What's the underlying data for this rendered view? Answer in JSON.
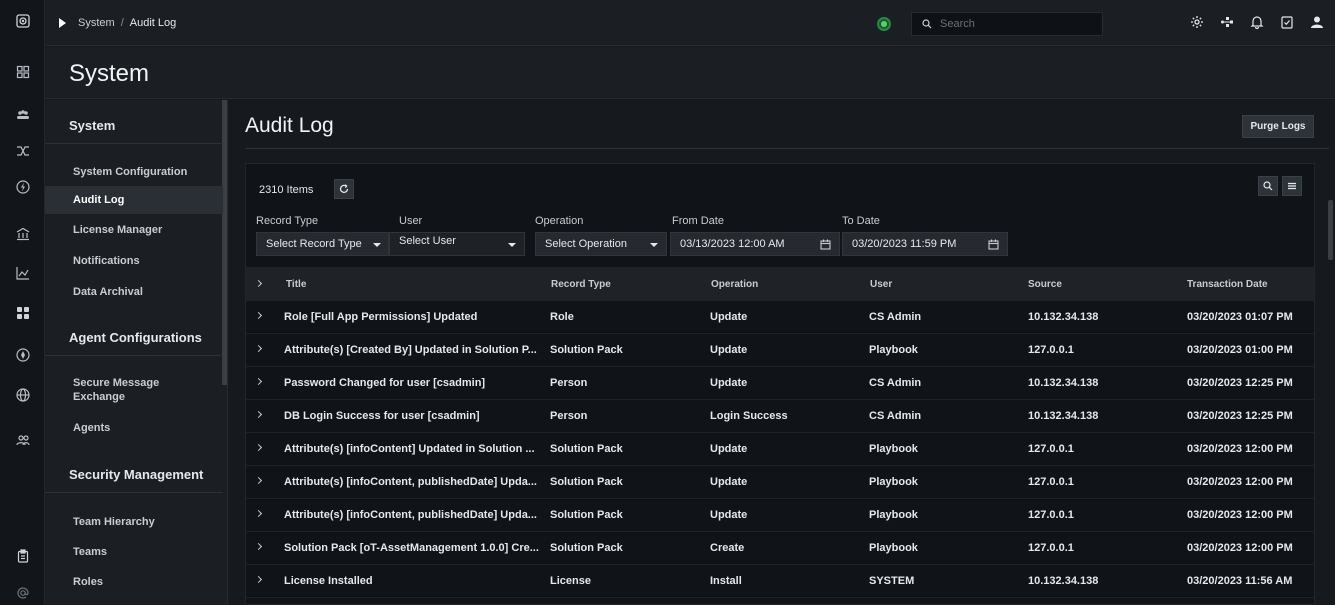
{
  "app": {
    "accent": "#2a8a3b",
    "rail_icons": [
      "logo-icon",
      "dashboard-icon",
      "team-icon",
      "shuffle-icon",
      "lightning-icon",
      "bank-icon",
      "chart-icon",
      "grid-icon",
      "compass-icon",
      "globe-icon",
      "people-icon",
      "clipboard-icon",
      "at-icon"
    ]
  },
  "topbar": {
    "breadcrumb": [
      "System",
      "Audit Log"
    ],
    "breadcrumb_sep": "/",
    "search_placeholder": "Search",
    "icons": [
      "gear-icon",
      "workflow-icon",
      "bell-icon",
      "checklist-icon",
      "user-icon"
    ]
  },
  "page": {
    "title": "System"
  },
  "sidebar": {
    "groups": [
      {
        "title": "System",
        "items": [
          {
            "label": "System Configuration"
          },
          {
            "label": "Audit Log",
            "active": true
          },
          {
            "label": "License Manager"
          },
          {
            "label": "Notifications"
          },
          {
            "label": "Data Archival"
          }
        ]
      },
      {
        "title": "Agent Configurations",
        "items": [
          {
            "label": "Secure Message Exchange"
          },
          {
            "label": "Agents"
          }
        ]
      },
      {
        "title": "Security Management",
        "items": [
          {
            "label": "Team Hierarchy"
          },
          {
            "label": "Teams"
          },
          {
            "label": "Roles"
          }
        ]
      }
    ]
  },
  "main": {
    "title": "Audit Log",
    "purge_label": "Purge Logs",
    "items_count": "2310 Items",
    "filters": {
      "record_type_label": "Record Type",
      "record_type_value": "Select Record Type",
      "user_label": "User",
      "user_value": "Select User",
      "operation_label": "Operation",
      "operation_value": "Select Operation",
      "from_label": "From Date",
      "from_value": "03/13/2023 12:00 AM",
      "to_label": "To Date",
      "to_value": "03/20/2023 11:59 PM"
    },
    "columns": [
      "Title",
      "Record Type",
      "Operation",
      "User",
      "Source",
      "Transaction Date"
    ],
    "rows": [
      [
        "Role [Full App Permissions] Updated",
        "Role",
        "Update",
        "CS Admin",
        "10.132.34.138",
        "03/20/2023 01:07 PM"
      ],
      [
        "Attribute(s) [Created By] Updated in Solution P...",
        "Solution Pack",
        "Update",
        "Playbook",
        "127.0.0.1",
        "03/20/2023 01:00 PM"
      ],
      [
        "Password Changed for user [csadmin]",
        "Person",
        "Update",
        "CS Admin",
        "10.132.34.138",
        "03/20/2023 12:25 PM"
      ],
      [
        "DB Login Success for user [csadmin]",
        "Person",
        "Login Success",
        "CS Admin",
        "10.132.34.138",
        "03/20/2023 12:25 PM"
      ],
      [
        "Attribute(s) [infoContent] Updated in Solution ...",
        "Solution Pack",
        "Update",
        "Playbook",
        "127.0.0.1",
        "03/20/2023 12:00 PM"
      ],
      [
        "Attribute(s) [infoContent, publishedDate] Upda...",
        "Solution Pack",
        "Update",
        "Playbook",
        "127.0.0.1",
        "03/20/2023 12:00 PM"
      ],
      [
        "Attribute(s) [infoContent, publishedDate] Upda...",
        "Solution Pack",
        "Update",
        "Playbook",
        "127.0.0.1",
        "03/20/2023 12:00 PM"
      ],
      [
        "Solution Pack [oT-AssetManagement 1.0.0] Cre...",
        "Solution Pack",
        "Create",
        "Playbook",
        "127.0.0.1",
        "03/20/2023 12:00 PM"
      ],
      [
        "License Installed",
        "License",
        "Install",
        "SYSTEM",
        "10.132.34.138",
        "03/20/2023 11:56 AM"
      ]
    ]
  }
}
